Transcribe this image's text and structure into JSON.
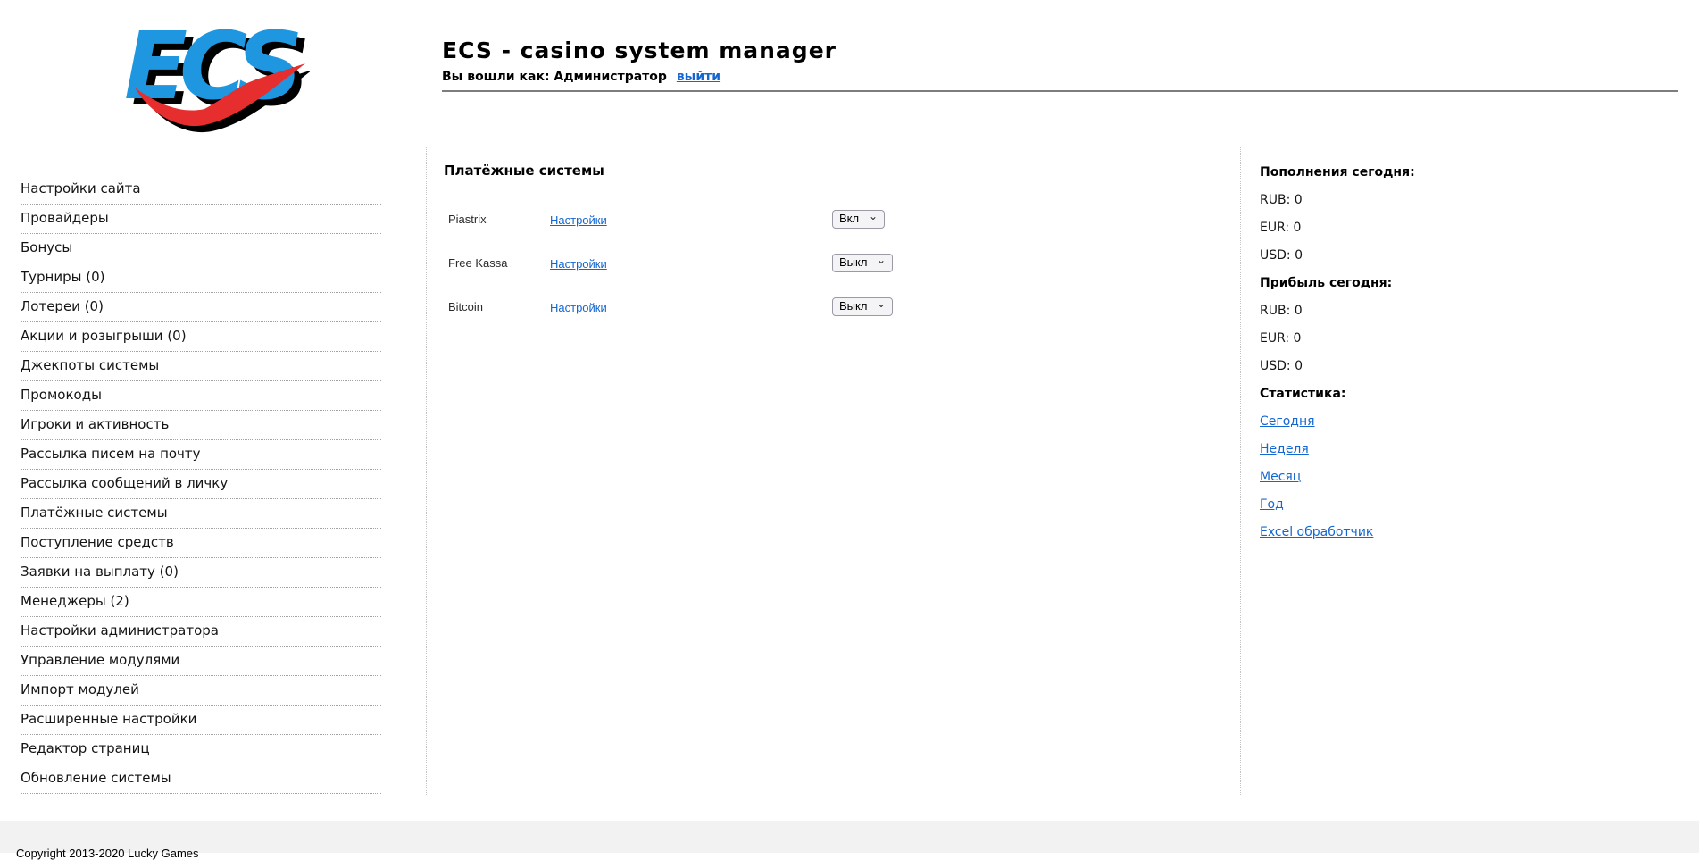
{
  "colors": {
    "logo_blue": "#1E96E0",
    "logo_red": "#E62E2E",
    "link_blue": "#1467D1"
  },
  "header": {
    "logo_text": "ECS",
    "title": "ECS - casino system manager",
    "login_prefix": "Вы вошли как: Администратор",
    "logout_label": "выйти"
  },
  "sidebar": {
    "items": [
      "Настройки сайта",
      "Провайдеры",
      "Бонусы",
      "Турниры (0)",
      "Лотереи (0)",
      "Акции и розыгрыши (0)",
      "Джекпоты системы",
      "Промокоды",
      "Игроки и активность",
      "Рассылка писем на почту",
      "Рассылка сообщений в личку",
      "Платёжные системы",
      "Поступление средств",
      "Заявки на выплату (0)",
      "Менеджеры (2)",
      "Настройки администратора",
      "Управление модулями",
      "Импорт модулей",
      "Расширенные настройки",
      "Редактор страниц",
      "Обновление системы"
    ]
  },
  "payments": {
    "heading": "Платёжные системы",
    "rows": [
      {
        "name": "Piastrix",
        "settings_label": "Настройки",
        "state": "Вкл"
      },
      {
        "name": "Free Kassa",
        "settings_label": "Настройки",
        "state": "Выкл"
      },
      {
        "name": "Bitcoin",
        "settings_label": "Настройки",
        "state": "Выкл"
      }
    ]
  },
  "stats_panel": {
    "deposits_title": "Пополнения сегодня:",
    "deposits": [
      "RUB: 0",
      "EUR: 0",
      "USD: 0"
    ],
    "profit_title": "Прибыль сегодня:",
    "profit": [
      "RUB: 0",
      "EUR: 0",
      "USD: 0"
    ],
    "stats_title": "Статистика:",
    "links": [
      "Сегодня",
      "Неделя",
      "Месяц",
      "Год",
      "Excel обработчик"
    ]
  },
  "footer": {
    "copyright": "Copyright 2013-2020 Lucky Games"
  }
}
